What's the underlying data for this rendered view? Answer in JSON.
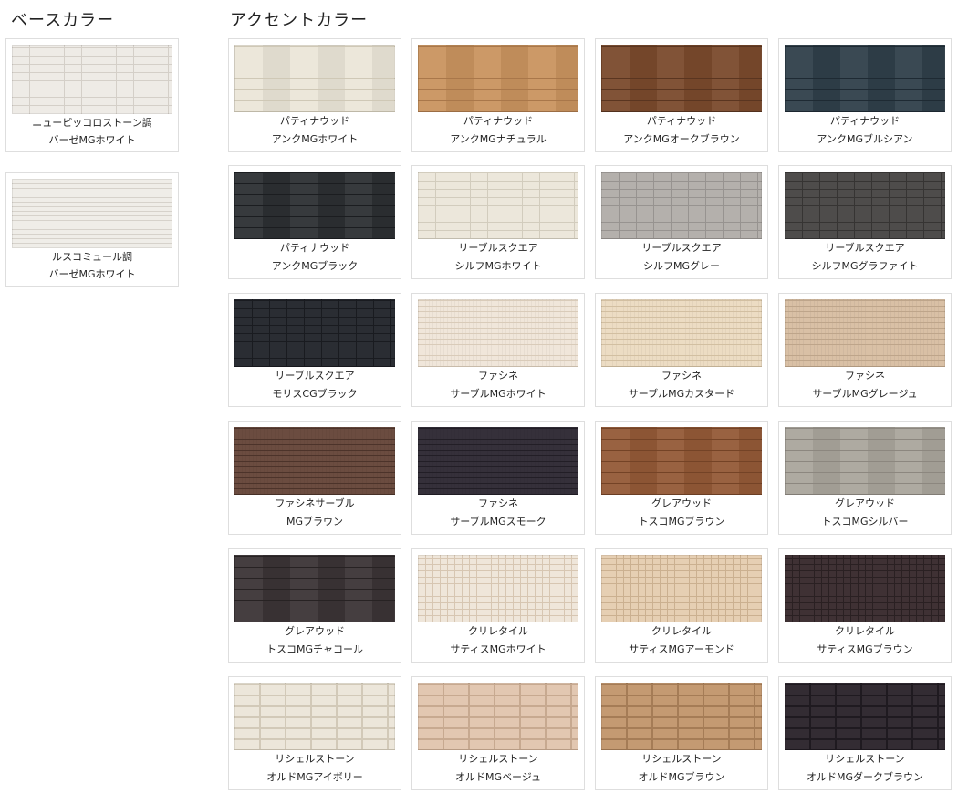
{
  "base": {
    "heading": "ベースカラー",
    "items": [
      {
        "line1": "ニューピッコロストーン調",
        "line2": "バーゼMGホワイト",
        "color": "#eeebe6",
        "line_color": "#d4cfc8",
        "pattern": "brick"
      },
      {
        "line1": "ルスコミュール調",
        "line2": "バーゼMGホワイト",
        "color": "#efede8",
        "line_color": "#d6d2cb",
        "pattern": "stripe"
      }
    ]
  },
  "accent": {
    "heading": "アクセントカラー",
    "items": [
      {
        "line1": "パティナウッド",
        "line2": "アンクMGホワイト",
        "color": "#ebe6d8",
        "line_color": "#cfc8b6",
        "pattern": "plank"
      },
      {
        "line1": "パティナウッド",
        "line2": "アンクMGナチュラル",
        "color": "#c9935f",
        "line_color": "#a9774a",
        "pattern": "plank"
      },
      {
        "line1": "パティナウッド",
        "line2": "アンクMGオークブラウン",
        "color": "#7a4a2c",
        "line_color": "#5a3520",
        "pattern": "plank"
      },
      {
        "line1": "パティナウッド",
        "line2": "アンクMGブルシアン",
        "color": "#2f3f4a",
        "line_color": "#1e2a33",
        "pattern": "plank"
      },
      {
        "line1": "パティナウッド",
        "line2": "アンクMGブラック",
        "color": "#2c2f33",
        "line_color": "#1b1d20",
        "pattern": "plank"
      },
      {
        "line1": "リーブルスクエア",
        "line2": "シルフMGホワイト",
        "color": "#ece7db",
        "line_color": "#d2ccbd",
        "pattern": "brick"
      },
      {
        "line1": "リーブルスクエア",
        "line2": "シルフMGグレー",
        "color": "#b4b0ac",
        "line_color": "#979390",
        "pattern": "brick"
      },
      {
        "line1": "リーブルスクエア",
        "line2": "シルフMGグラファイト",
        "color": "#4e4c4b",
        "line_color": "#363433",
        "pattern": "brick"
      },
      {
        "line1": "リーブルスクエア",
        "line2": "モリスCGブラック",
        "color": "#2a2d33",
        "line_color": "#191b20",
        "pattern": "brick"
      },
      {
        "line1": "ファシネ",
        "line2": "サーブルMGホワイト",
        "color": "#f0e6da",
        "line_color": "#d9cbb9",
        "pattern": "fine"
      },
      {
        "line1": "ファシネ",
        "line2": "サーブルMGカスタード",
        "color": "#ecdcc3",
        "line_color": "#d2bfa1",
        "pattern": "fine"
      },
      {
        "line1": "ファシネ",
        "line2": "サーブルMGグレージュ",
        "color": "#d9c0a5",
        "line_color": "#bea58a",
        "pattern": "fine"
      },
      {
        "line1": "ファシネサーブル",
        "line2": "MGブラウン",
        "color": "#6b4c40",
        "line_color": "#4c332a",
        "pattern": "fine"
      },
      {
        "line1": "ファシネ",
        "line2": "サーブルMGスモーク",
        "color": "#35303a",
        "line_color": "#221e26",
        "pattern": "fine"
      },
      {
        "line1": "グレアウッド",
        "line2": "トスコMGブラウン",
        "color": "#945a37",
        "line_color": "#744326",
        "pattern": "plank"
      },
      {
        "line1": "グレアウッド",
        "line2": "トスコMGシルバー",
        "color": "#aaa59c",
        "line_color": "#8c877f",
        "pattern": "plank"
      },
      {
        "line1": "グレアウッド",
        "line2": "トスコMGチャコール",
        "color": "#3b3436",
        "line_color": "#272223",
        "pattern": "plank"
      },
      {
        "line1": "クリレタイル",
        "line2": "サティスMGホワイト",
        "color": "#efe6da",
        "line_color": "#d7c6b2",
        "pattern": "tile"
      },
      {
        "line1": "クリレタイル",
        "line2": "サティスMGアーモンド",
        "color": "#e6cfb3",
        "line_color": "#cbb090",
        "pattern": "tile"
      },
      {
        "line1": "クリレタイル",
        "line2": "サティスMGブラウン",
        "color": "#3f3134",
        "line_color": "#2a2022",
        "pattern": "tile"
      },
      {
        "line1": "リシェルストーン",
        "line2": "オルドMGアイボリー",
        "color": "#ece6da",
        "line_color": "#d2c9b8",
        "pattern": "stone"
      },
      {
        "line1": "リシェルストーン",
        "line2": "オルドMGベージュ",
        "color": "#e2c7b1",
        "line_color": "#c7a990",
        "pattern": "stone"
      },
      {
        "line1": "リシェルストーン",
        "line2": "オルドMGブラウン",
        "color": "#c49a72",
        "line_color": "#a57c56",
        "pattern": "stone"
      },
      {
        "line1": "リシェルストーン",
        "line2": "オルドMGダークブラウン",
        "color": "#332c33",
        "line_color": "#1f1a20",
        "pattern": "stone"
      }
    ]
  }
}
